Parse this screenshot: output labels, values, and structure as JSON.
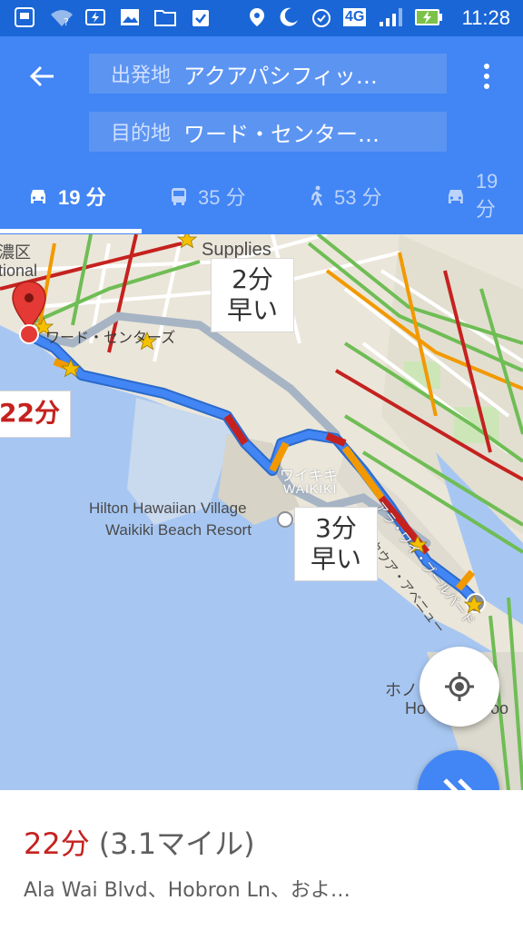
{
  "status_bar": {
    "time": "11:28",
    "network": "4G",
    "icons": [
      "screen-share-icon",
      "wifi-unknown-icon",
      "battery-saver-icon",
      "image-icon",
      "folder-icon",
      "clipboard-check-icon",
      "location-icon",
      "night-mode-icon",
      "alarm-icon",
      "network-4g-icon",
      "signal-icon",
      "battery-charging-icon"
    ]
  },
  "header": {
    "origin_label": "出発地",
    "origin_value": "アクアパシフィッ…",
    "destination_label": "目的地",
    "destination_value": "ワード・センター…",
    "modes": [
      {
        "icon": "car-icon",
        "label": "19 分"
      },
      {
        "icon": "bus-icon",
        "label": "35 分"
      },
      {
        "icon": "walk-icon",
        "label": "53 分"
      },
      {
        "icon": "car-icon",
        "label": "19 分"
      }
    ]
  },
  "map": {
    "labels": {
      "ward_district": "濃区",
      "national": "tional",
      "supplies": "Supplies",
      "ward_centers": "ワード・センターズ",
      "waikiki_jp": "ワイキキ",
      "waikiki_en": "WAIKĪKĪ",
      "hilton_line1": "Hilton Hawaiian Village",
      "hilton_line2": "Waikiki Beach Resort",
      "ala_wai": "アラ・ワイ・ブールバード",
      "kuhio": "カラカウア・アベニュー",
      "hono": "ホノ",
      "hono_zoo": "Ho",
      "zoo_tail": "oo"
    },
    "callouts": {
      "faster_2min_time": "2分",
      "faster_2min_text": "早い",
      "faster_3min_time": "3分",
      "faster_3min_text": "早い",
      "selected_time": "22分"
    },
    "colors": {
      "route_blue": "#4285f4",
      "traffic_orange": "#f29900",
      "traffic_red": "#c5221f",
      "alt_route_gray": "#a6b4c4",
      "water": "#a7c7f2",
      "land": "#ebe6da"
    }
  },
  "summary": {
    "time": "22分",
    "distance": "(3.1マイル)",
    "via": "Ala Wai Blvd、Hobron Ln、およ…"
  }
}
